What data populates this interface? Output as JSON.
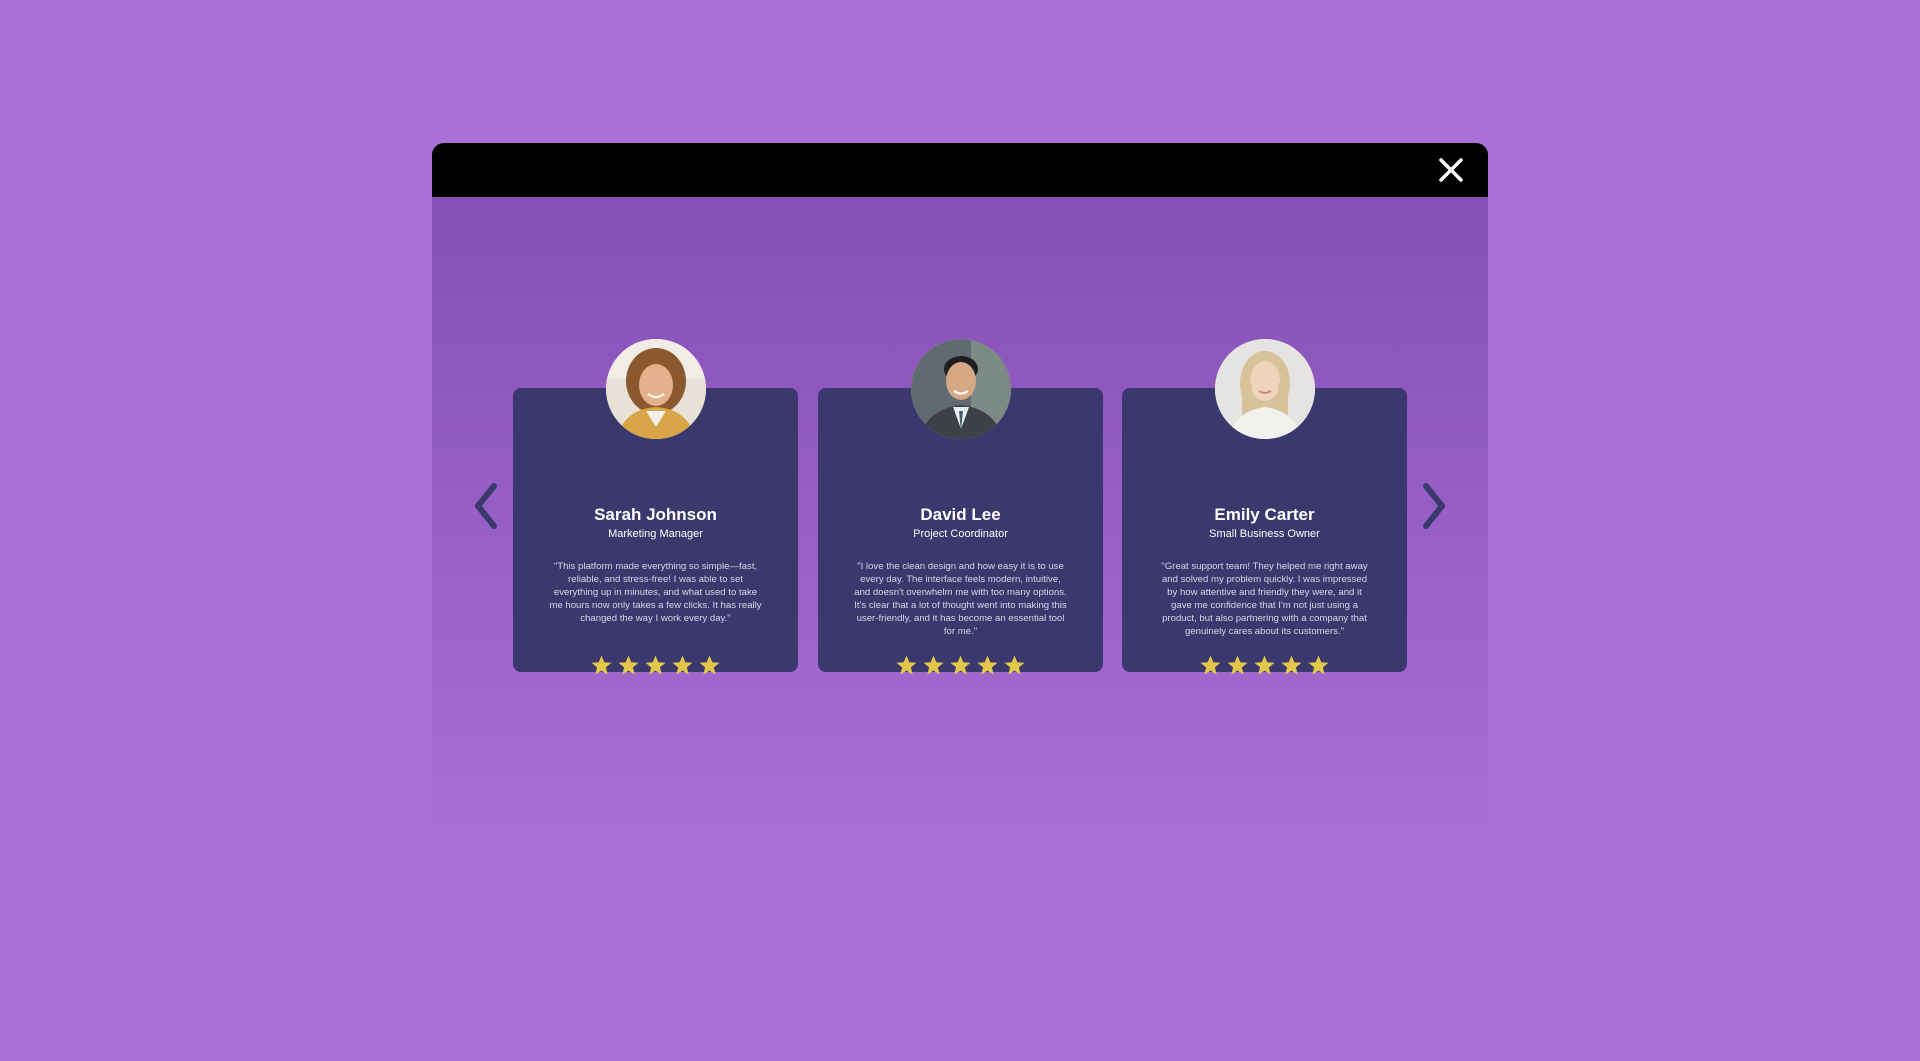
{
  "colors": {
    "page_background": "#ac6fd8",
    "modal_header": "#000000",
    "card_background": "#3a386d",
    "star": "#e2c84a",
    "arrow": "#3a386d"
  },
  "modal": {
    "close_icon": "close-icon"
  },
  "carousel": {
    "prev_icon": "chevron-left-icon",
    "next_icon": "chevron-right-icon",
    "testimonials": [
      {
        "name": "Sarah Johnson",
        "role": "Marketing Manager",
        "quote": "\"This platform made everything so simple—fast, reliable, and stress-free! I was able to set everything up in minutes, and what used to take me hours now only takes a few clicks. It has really changed the way I work every day.\"",
        "rating": 5
      },
      {
        "name": "David Lee",
        "role": "Project Coordinator",
        "quote": "\"I love the clean design and how easy it is to use every day. The interface feels modern, intuitive, and doesn't overwhelm me with too many options. It's clear that a lot of thought went into making this user-friendly, and it has become an essential tool for me.\"",
        "rating": 5
      },
      {
        "name": "Emily Carter",
        "role": "Small Business Owner",
        "quote": "\"Great support team! They helped me right away and solved my problem quickly. I was impressed by how attentive and friendly they were, and it gave me confidence that I'm not just using a product, but also partnering with a company that genuinely cares about its customers.\"",
        "rating": 5
      }
    ]
  }
}
